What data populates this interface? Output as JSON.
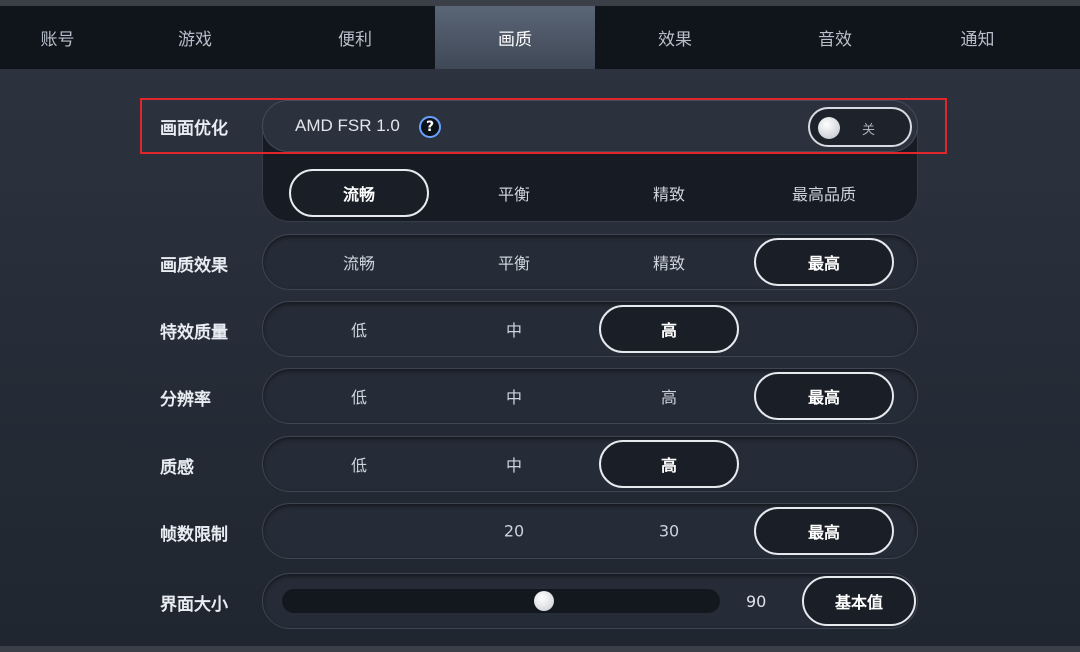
{
  "tabs": [
    {
      "label": "账号"
    },
    {
      "label": "游戏"
    },
    {
      "label": "便利"
    },
    {
      "label": "画质"
    },
    {
      "label": "效果"
    },
    {
      "label": "音效"
    },
    {
      "label": "通知"
    }
  ],
  "active_tab": "画质",
  "image_optimization": {
    "label": "画面优化",
    "fsr_name": "AMD FSR 1.0",
    "help_icon": "?",
    "toggle": {
      "state_label": "关",
      "on": false
    },
    "presets": [
      "流畅",
      "平衡",
      "精致",
      "最高品质"
    ],
    "selected_preset": "流畅"
  },
  "quality_effect": {
    "label": "画质效果",
    "options": [
      "流畅",
      "平衡",
      "精致",
      "最高"
    ],
    "selected": "最高"
  },
  "fx_quality": {
    "label": "特效质量",
    "options": [
      "低",
      "中",
      "高"
    ],
    "selected": "高"
  },
  "resolution": {
    "label": "分辨率",
    "options": [
      "低",
      "中",
      "高",
      "最高"
    ],
    "selected": "最高"
  },
  "texture": {
    "label": "质感",
    "options": [
      "低",
      "中",
      "高"
    ],
    "selected": "高"
  },
  "frame_limit": {
    "label": "帧数限制",
    "options": [
      "20",
      "30",
      "最高"
    ],
    "selected": "最高"
  },
  "ui_size": {
    "label": "界面大小",
    "value": "90",
    "slider_fraction": 0.6,
    "reset_label": "基本值"
  },
  "colors": {
    "highlight": "#e0262b",
    "help_ring": "#6aa3ff",
    "active_tab": "#5a6576"
  }
}
